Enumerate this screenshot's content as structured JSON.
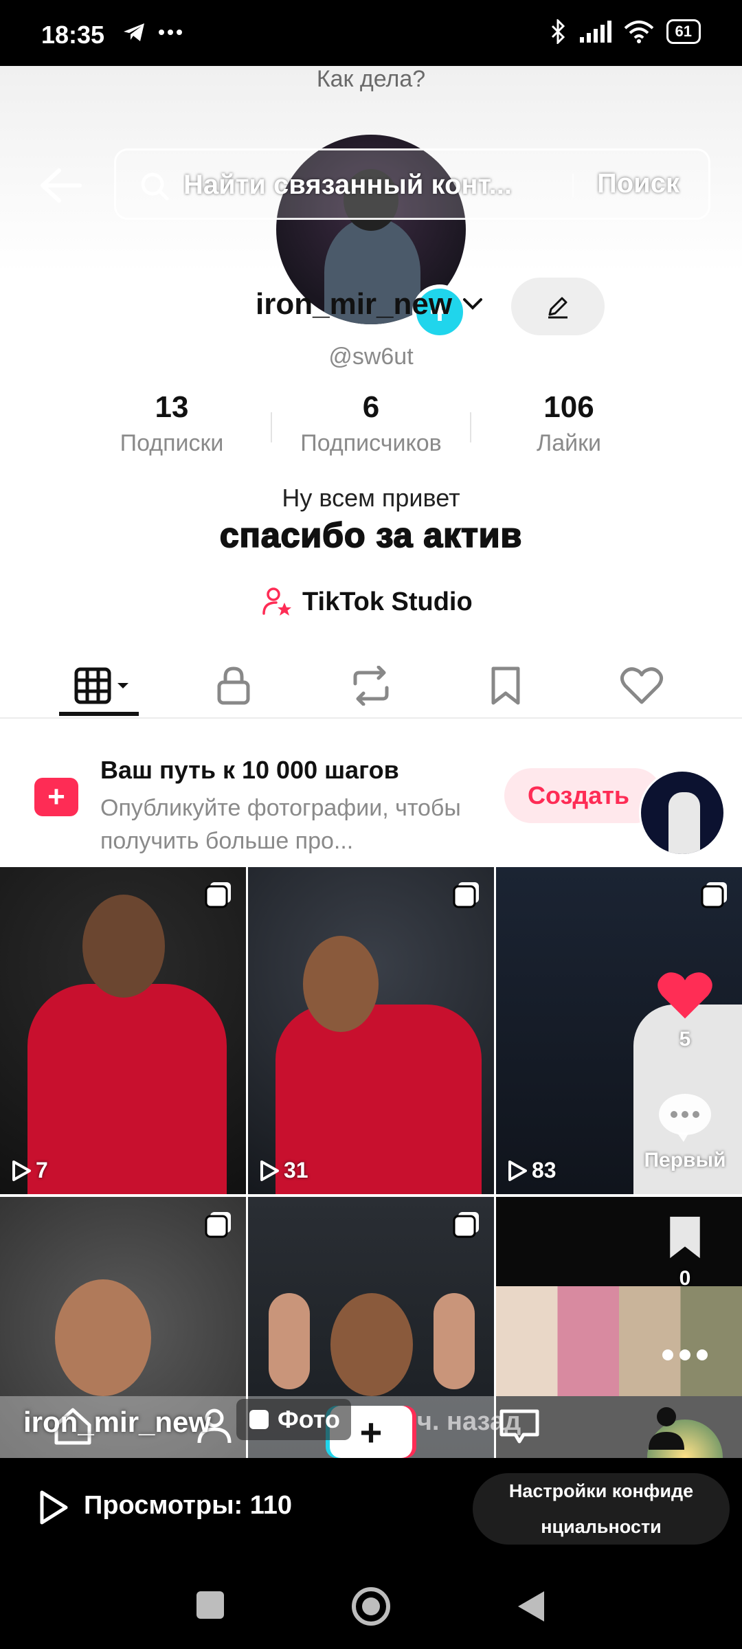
{
  "status_bar": {
    "time": "18:35",
    "battery": "61",
    "icons": [
      "telegram-icon",
      "more-dots-icon",
      "bluetooth-icon",
      "signal-icon",
      "wifi-icon",
      "battery-icon"
    ]
  },
  "profile": {
    "greeting": "Как дела?",
    "display_name": "iron_mir_new",
    "username": "@sw6ut",
    "stats": [
      {
        "value": "13",
        "label": "Подписки"
      },
      {
        "value": "6",
        "label": "Подписчиков"
      },
      {
        "value": "106",
        "label": "Лайки"
      }
    ],
    "bio_line1": "Ну всем привет",
    "bio_line2": "спасибо за актив",
    "studio_label": "TikTok Studio"
  },
  "search": {
    "placeholder": "Найти связанный конт...",
    "button_label": "Поиск"
  },
  "promo": {
    "title": "Ваш путь к 10 000 шагов",
    "description": "Опубликуйте фотографии, чтобы получить больше про...",
    "create_label": "Создать"
  },
  "grid": {
    "cells": [
      {
        "views": "7"
      },
      {
        "views": "31"
      },
      {
        "views": "83"
      },
      {
        "views": ""
      },
      {
        "views": ""
      },
      {
        "views": ""
      }
    ]
  },
  "rail": {
    "likes": "5",
    "comment_label": "Первый",
    "saves": "0"
  },
  "caption": {
    "user": "iron_mir_new",
    "tag": "Фото",
    "time": "18 ч. назад"
  },
  "views_bar": {
    "label": "Просмотры: 110",
    "privacy_line1": "Настройки конфиде",
    "privacy_line2": "нциальности"
  },
  "colors": {
    "accent_pink": "#fe2c55",
    "accent_cyan": "#20d5ec",
    "like_red": "#ff2d55"
  }
}
